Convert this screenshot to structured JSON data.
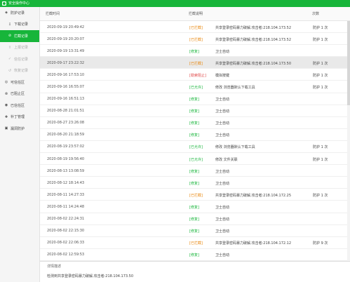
{
  "window": {
    "title": "安全操作中心"
  },
  "sidebar": {
    "items": [
      {
        "label": "防护记录",
        "icon": "shield-icon",
        "type": "group"
      },
      {
        "label": "下载记录",
        "icon": "download-icon",
        "type": "sub"
      },
      {
        "label": "拦截记录",
        "icon": "block-icon",
        "type": "sub-active"
      },
      {
        "label": "上报记录",
        "icon": "upload-icon",
        "type": "sub-dim"
      },
      {
        "label": "信任记录",
        "icon": "trust-icon",
        "type": "sub-dim"
      },
      {
        "label": "恢复记录",
        "icon": "restore-icon",
        "type": "sub-dim"
      },
      {
        "label": "可信任区",
        "icon": "trusted-zone-icon",
        "type": "group"
      },
      {
        "label": "已阻止区",
        "icon": "blocked-zone-icon",
        "type": "group"
      },
      {
        "label": "已信任区",
        "icon": "trusted-icon",
        "type": "group"
      },
      {
        "label": "补丁管理",
        "icon": "patch-icon",
        "type": "group"
      },
      {
        "label": "漏洞防护",
        "icon": "vuln-icon",
        "type": "group"
      }
    ]
  },
  "table": {
    "headers": {
      "time": "拦截时间",
      "desc": "拦截说明",
      "count": "次数"
    },
    "rows": [
      {
        "time": "2020-09-19 20:49:42",
        "tag": "[已拦截]",
        "tag_kind": "blocked",
        "desc": "共享登录密码暴力破解,攻击者:218.104.173.52",
        "count": "防护 1 次"
      },
      {
        "time": "2020-09-19 20:20:07",
        "tag": "[已拦截]",
        "tag_kind": "blocked",
        "desc": "共享登录密码暴力破解,攻击者:218.104.173.52",
        "count": "防护 1 次"
      },
      {
        "time": "2020-09-19 13:31:49",
        "tag": "[修复]",
        "tag_kind": "repaired",
        "desc": "卫士自动",
        "count": ""
      },
      {
        "time": "2020-09-17 23:22:32",
        "tag": "[已拦截]",
        "tag_kind": "blocked",
        "desc": "共享登录密码暴力破解,攻击者:218.104.173.50",
        "count": "防护 1 次"
      },
      {
        "time": "2020-09-16 17:53:10",
        "tag": "[勒索阻止]",
        "tag_kind": "prevent",
        "desc": "模拟按键",
        "count": "防护 1 次"
      },
      {
        "time": "2020-09-16 16:55:07",
        "tag": "[已允许]",
        "tag_kind": "repaired",
        "desc": "修改 浏览器默认下载工具",
        "count": "防护 1 次"
      },
      {
        "time": "2020-09-16 16:51:13",
        "tag": "[修复]",
        "tag_kind": "repaired",
        "desc": "卫士自动",
        "count": ""
      },
      {
        "time": "2020-08-28 21:01:51",
        "tag": "[修复]",
        "tag_kind": "repaired",
        "desc": "卫士自动",
        "count": ""
      },
      {
        "time": "2020-08-27 23:26:08",
        "tag": "[修复]",
        "tag_kind": "repaired",
        "desc": "卫士自动",
        "count": ""
      },
      {
        "time": "2020-08-20 21:18:59",
        "tag": "[修复]",
        "tag_kind": "repaired",
        "desc": "卫士自动",
        "count": ""
      },
      {
        "time": "2020-08-19 23:57:02",
        "tag": "[已允许]",
        "tag_kind": "repaired",
        "desc": "修改 浏览器默认下载工具",
        "count": "防护 1 次"
      },
      {
        "time": "2020-08-19 19:56:40",
        "tag": "[已允许]",
        "tag_kind": "repaired",
        "desc": "修改 文件关联",
        "count": "防护 1 次"
      },
      {
        "time": "2020-08-13 13:08:59",
        "tag": "[修复]",
        "tag_kind": "repaired",
        "desc": "卫士自动",
        "count": ""
      },
      {
        "time": "2020-08-12 18:14:43",
        "tag": "[修复]",
        "tag_kind": "repaired",
        "desc": "卫士自动",
        "count": ""
      },
      {
        "time": "2020-08-11 14:27:33",
        "tag": "[已拦截]",
        "tag_kind": "blocked",
        "desc": "共享登录密码暴力破解,攻击者:218.104.172.25",
        "count": "防护 1 次"
      },
      {
        "time": "2020-08-11 14:24:48",
        "tag": "[修复]",
        "tag_kind": "repaired",
        "desc": "卫士自动",
        "count": ""
      },
      {
        "time": "2020-08-02 22:24:31",
        "tag": "[修复]",
        "tag_kind": "repaired",
        "desc": "卫士自动",
        "count": ""
      },
      {
        "time": "2020-08-02 22:15:30",
        "tag": "[修复]",
        "tag_kind": "repaired",
        "desc": "卫士自动",
        "count": ""
      },
      {
        "time": "2020-08-02 22:06:33",
        "tag": "[已拦截]",
        "tag_kind": "blocked",
        "desc": "共享登录密码暴力破解,攻击者:218.104.172.12",
        "count": "防护 9 次"
      },
      {
        "time": "2020-08-02 12:59:53",
        "tag": "[修复]",
        "tag_kind": "repaired",
        "desc": "卫士自动",
        "count": ""
      }
    ],
    "selected_index": 3
  },
  "detail": {
    "title": "详情描述",
    "text": "检测到共享登录密码暴力破解,攻击者:218.104.173.50"
  },
  "colors": {
    "accent": "#17b53a",
    "blocked": "#e8860c",
    "prevent": "#e04b4b"
  }
}
